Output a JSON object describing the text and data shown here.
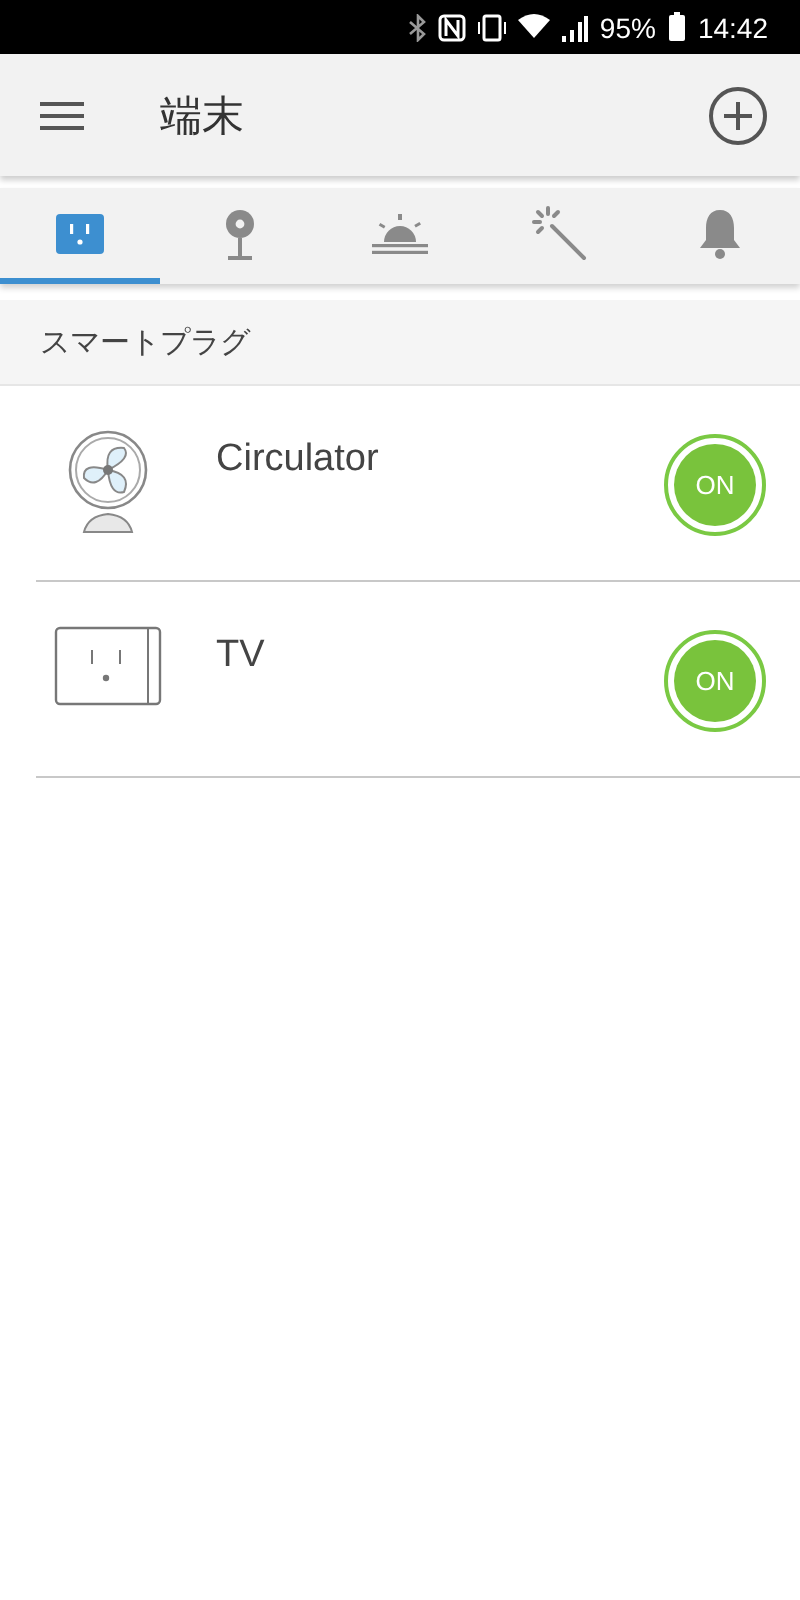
{
  "status_bar": {
    "battery": "95%",
    "time": "14:42"
  },
  "app_bar": {
    "title": "端末"
  },
  "tabs": [
    {
      "kind": "plug",
      "selected": true
    },
    {
      "kind": "camera",
      "selected": false
    },
    {
      "kind": "sunrise",
      "selected": false
    },
    {
      "kind": "wand",
      "selected": false
    },
    {
      "kind": "bell",
      "selected": false
    }
  ],
  "section": {
    "title": "スマートプラグ"
  },
  "devices": [
    {
      "kind": "fan",
      "name": "Circulator",
      "on": true,
      "power_label": "ON"
    },
    {
      "kind": "plug",
      "name": "TV",
      "on": true,
      "power_label": "ON"
    }
  ]
}
